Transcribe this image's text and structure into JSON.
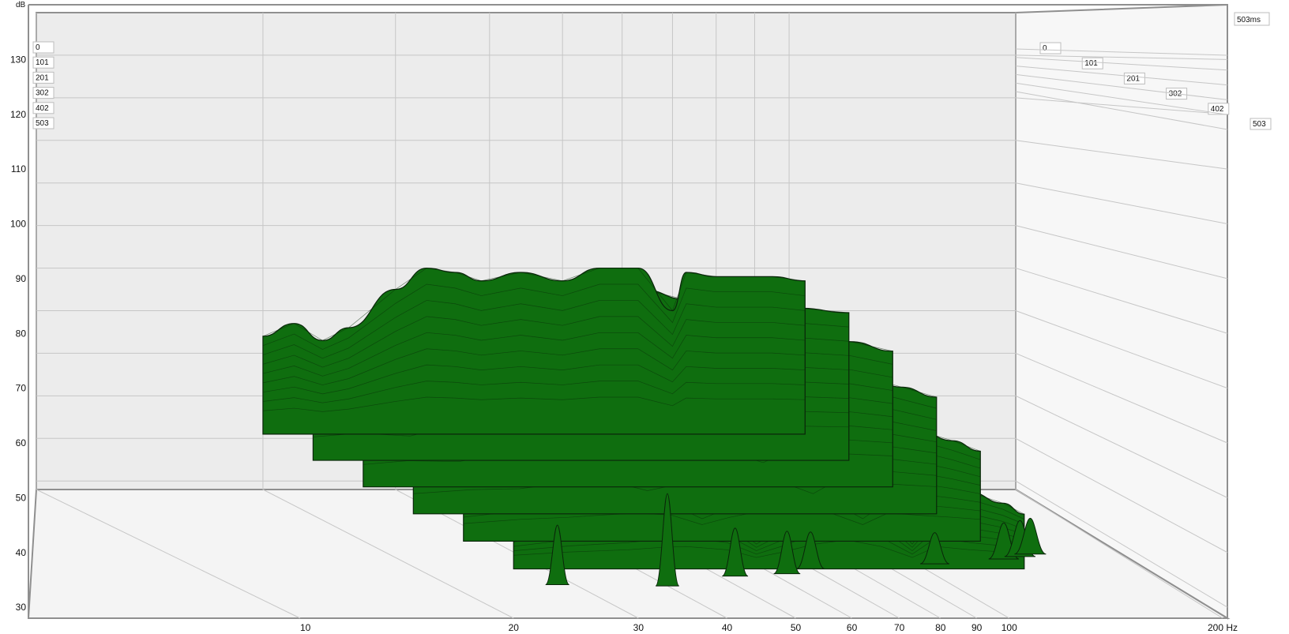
{
  "chart_data": {
    "type": "waterfall",
    "units": {
      "y": "dB",
      "x": "Hz",
      "time": "ms"
    },
    "y_axis": {
      "label": "dB",
      "range": [
        28,
        140
      ],
      "ticks": [
        30,
        40,
        50,
        60,
        70,
        80,
        90,
        100,
        110,
        120,
        130
      ]
    },
    "x_axis": {
      "unit_label": "Hz",
      "range": [
        10,
        200
      ],
      "ticks": [
        {
          "value": 10,
          "label": "10"
        },
        {
          "value": 20,
          "label": "20"
        },
        {
          "value": 30,
          "label": "30"
        },
        {
          "value": 40,
          "label": "40"
        },
        {
          "value": 50,
          "label": "50"
        },
        {
          "value": 60,
          "label": "60"
        },
        {
          "value": 70,
          "label": "70"
        },
        {
          "value": 80,
          "label": "80"
        },
        {
          "value": 90,
          "label": "90"
        },
        {
          "value": 100,
          "label": "100"
        },
        {
          "value": 200,
          "label": "200 Hz"
        }
      ]
    },
    "time_axis": {
      "max_label": "503ms",
      "ticks": [
        {
          "value": 0,
          "label": "0"
        },
        {
          "value": 101,
          "label": "101"
        },
        {
          "value": 201,
          "label": "201"
        },
        {
          "value": 302,
          "label": "302"
        },
        {
          "value": 402,
          "label": "402"
        },
        {
          "value": 503,
          "label": "503"
        }
      ]
    },
    "display": {
      "grid": true,
      "fill_color": "#0f6e0f",
      "outline_color": "#0a250a",
      "frame_color": "#8f8f8f",
      "grid_color": "#c6c6c6",
      "back_wall_color": "#ececec",
      "floor_color": "#f4f4f4",
      "right_wall_color": "#f7f7f7"
    },
    "series": [
      {
        "slice": 0,
        "points": [
          {
            "x": 20.0,
            "y": 64
          },
          {
            "x": 22.0,
            "y": 67
          },
          {
            "x": 24.0,
            "y": 63
          },
          {
            "x": 26.0,
            "y": 66
          },
          {
            "x": 30.0,
            "y": 75
          },
          {
            "x": 33.0,
            "y": 80
          },
          {
            "x": 36.0,
            "y": 79
          },
          {
            "x": 39.0,
            "y": 77
          },
          {
            "x": 44.0,
            "y": 79
          },
          {
            "x": 50.0,
            "y": 77
          },
          {
            "x": 56.0,
            "y": 80
          },
          {
            "x": 63.0,
            "y": 80
          },
          {
            "x": 70.0,
            "y": 70
          },
          {
            "x": 73.0,
            "y": 79
          },
          {
            "x": 80.0,
            "y": 78
          },
          {
            "x": 87.0,
            "y": 78
          },
          {
            "x": 95.0,
            "y": 78
          },
          {
            "x": 105.0,
            "y": 77
          }
        ]
      },
      {
        "slice": 1,
        "points": [
          {
            "x": 20.0,
            "y": 62
          },
          {
            "x": 23.0,
            "y": 66
          },
          {
            "x": 27.0,
            "y": 63
          },
          {
            "x": 30.0,
            "y": 72
          },
          {
            "x": 33.0,
            "y": 77
          },
          {
            "x": 36.0,
            "y": 76
          },
          {
            "x": 40.0,
            "y": 73
          },
          {
            "x": 44.0,
            "y": 76
          },
          {
            "x": 50.0,
            "y": 75
          },
          {
            "x": 56.0,
            "y": 78
          },
          {
            "x": 63.0,
            "y": 76
          },
          {
            "x": 70.0,
            "y": 66
          },
          {
            "x": 74.0,
            "y": 76
          },
          {
            "x": 80.0,
            "y": 75
          },
          {
            "x": 90.0,
            "y": 74
          },
          {
            "x": 105.0,
            "y": 73
          }
        ]
      },
      {
        "slice": 2,
        "points": [
          {
            "x": 20.0,
            "y": 59
          },
          {
            "x": 23.0,
            "y": 63
          },
          {
            "x": 27.0,
            "y": 62
          },
          {
            "x": 30.0,
            "y": 69
          },
          {
            "x": 34.0,
            "y": 73
          },
          {
            "x": 37.0,
            "y": 72
          },
          {
            "x": 41.0,
            "y": 66
          },
          {
            "x": 45.0,
            "y": 71
          },
          {
            "x": 50.0,
            "y": 72
          },
          {
            "x": 56.0,
            "y": 75
          },
          {
            "x": 63.0,
            "y": 72
          },
          {
            "x": 70.0,
            "y": 61
          },
          {
            "x": 75.0,
            "y": 72
          },
          {
            "x": 82.0,
            "y": 71
          },
          {
            "x": 92.0,
            "y": 70
          },
          {
            "x": 105.0,
            "y": 68
          }
        ]
      },
      {
        "slice": 3,
        "points": [
          {
            "x": 20.0,
            "y": 55
          },
          {
            "x": 24.0,
            "y": 59
          },
          {
            "x": 28.0,
            "y": 60
          },
          {
            "x": 31.0,
            "y": 64
          },
          {
            "x": 34.0,
            "y": 67
          },
          {
            "x": 38.0,
            "y": 66
          },
          {
            "x": 42.0,
            "y": 58
          },
          {
            "x": 46.0,
            "y": 64
          },
          {
            "x": 51.0,
            "y": 68
          },
          {
            "x": 57.0,
            "y": 71
          },
          {
            "x": 64.0,
            "y": 67
          },
          {
            "x": 71.0,
            "y": 55
          },
          {
            "x": 76.0,
            "y": 67
          },
          {
            "x": 84.0,
            "y": 66
          },
          {
            "x": 94.0,
            "y": 64
          },
          {
            "x": 105.0,
            "y": 62
          }
        ]
      },
      {
        "slice": 4,
        "points": [
          {
            "x": 20.0,
            "y": 51
          },
          {
            "x": 24.0,
            "y": 55
          },
          {
            "x": 28.0,
            "y": 57
          },
          {
            "x": 31.0,
            "y": 59
          },
          {
            "x": 35.0,
            "y": 61
          },
          {
            "x": 39.0,
            "y": 59
          },
          {
            "x": 43.0,
            "y": 50
          },
          {
            "x": 47.0,
            "y": 57
          },
          {
            "x": 52.0,
            "y": 63
          },
          {
            "x": 58.0,
            "y": 66
          },
          {
            "x": 65.0,
            "y": 61
          },
          {
            "x": 72.0,
            "y": 50
          },
          {
            "x": 78.0,
            "y": 61
          },
          {
            "x": 86.0,
            "y": 59
          },
          {
            "x": 96.0,
            "y": 57
          },
          {
            "x": 105.0,
            "y": 55
          }
        ]
      },
      {
        "slice": 5,
        "points": [
          {
            "x": 20.0,
            "y": 46
          },
          {
            "x": 24.0,
            "y": 49
          },
          {
            "x": 29.0,
            "y": 51
          },
          {
            "x": 32.0,
            "y": 53
          },
          {
            "x": 35.0,
            "y": 54
          },
          {
            "x": 40.0,
            "y": 51
          },
          {
            "x": 44.0,
            "y": 44
          },
          {
            "x": 48.0,
            "y": 49
          },
          {
            "x": 53.0,
            "y": 56
          },
          {
            "x": 59.0,
            "y": 60
          },
          {
            "x": 66.0,
            "y": 54
          },
          {
            "x": 73.0,
            "y": 44
          },
          {
            "x": 79.0,
            "y": 54
          },
          {
            "x": 88.0,
            "y": 51
          },
          {
            "x": 98.0,
            "y": 49
          },
          {
            "x": 105.0,
            "y": 47
          }
        ]
      }
    ]
  }
}
